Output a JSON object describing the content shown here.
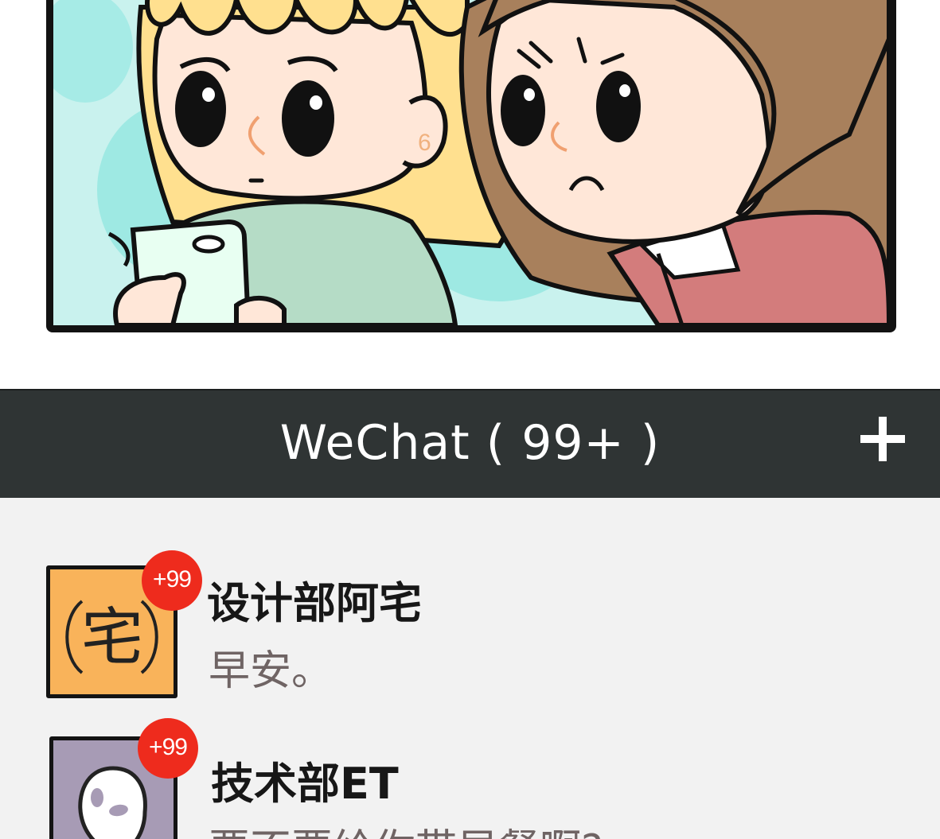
{
  "header": {
    "title": "WeChat ( 99+ )",
    "add_icon": "plus-icon"
  },
  "chats": [
    {
      "name": "设计部阿宅",
      "last_message": "早安。",
      "unread_badge": "+99",
      "avatar_icon": "zhai-character-avatar",
      "avatar_text": "宅",
      "avatar_color": "#f9b35a"
    },
    {
      "name": "技术部ET",
      "last_message": "要不要给你带早餐啊?",
      "unread_badge": "+99",
      "avatar_icon": "alien-face-avatar",
      "avatar_color": "#a79bb5"
    }
  ],
  "colors": {
    "header_bg": "#2f3434",
    "list_bg": "#f2f2f2",
    "badge": "#ee2b1d",
    "message_text": "#6f6464"
  },
  "comic": {
    "description_icon": "comic-panel-two-girls-looking-at-phone"
  }
}
